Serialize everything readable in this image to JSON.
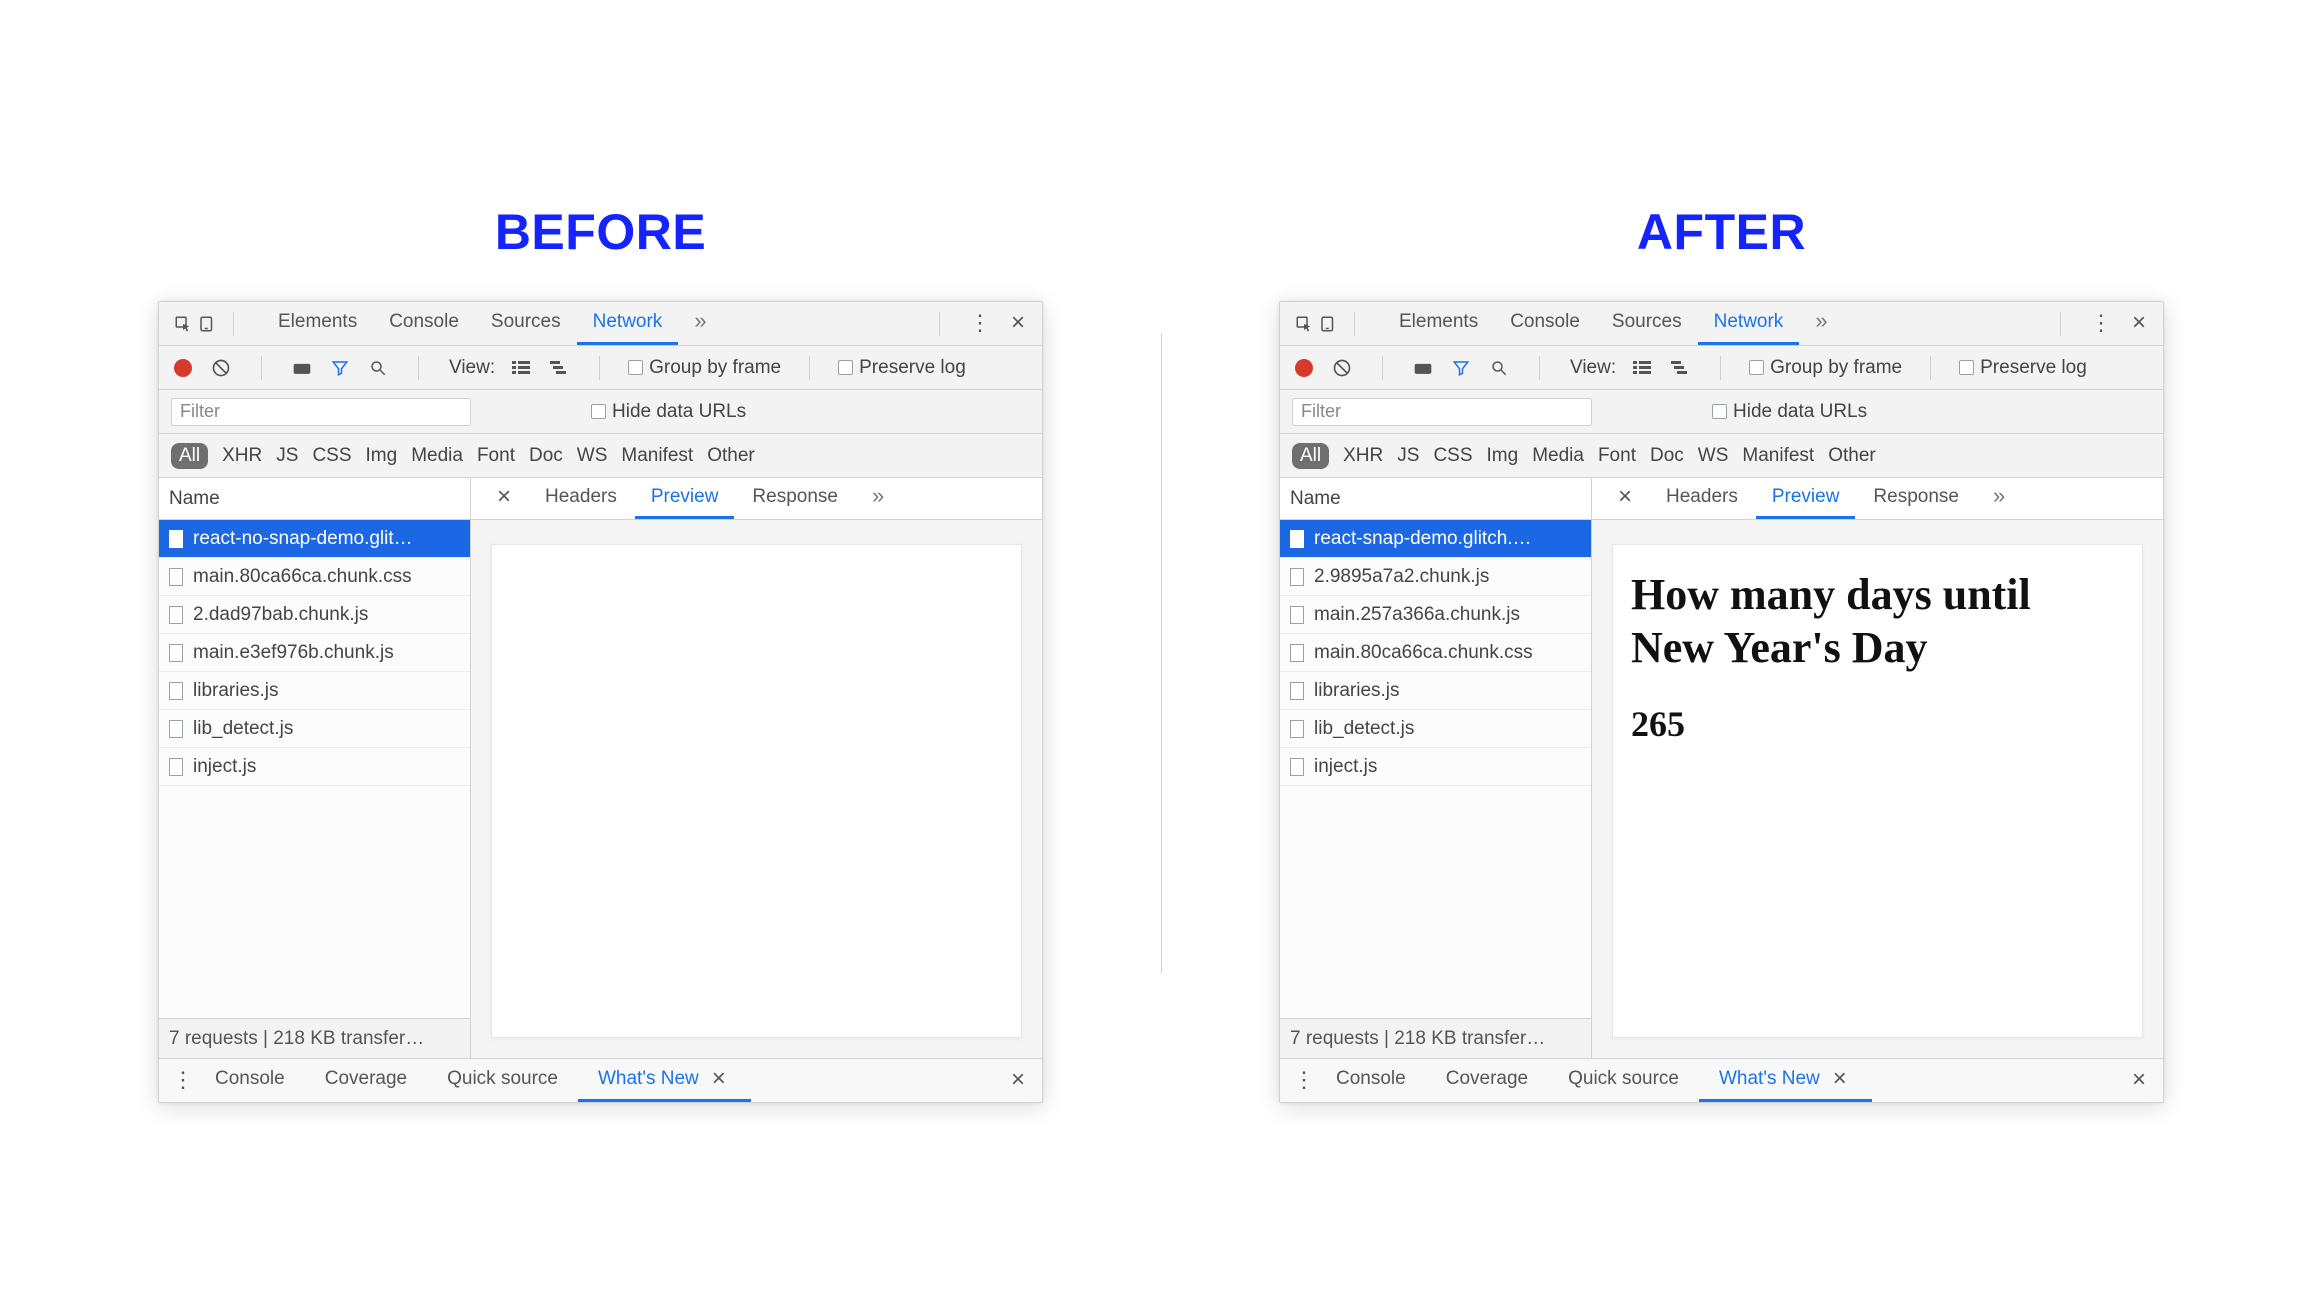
{
  "labels": {
    "before": "BEFORE",
    "after": "AFTER"
  },
  "top_tabs": {
    "elements": "Elements",
    "console": "Console",
    "sources": "Sources",
    "network": "Network"
  },
  "toolbar": {
    "view": "View:",
    "group_by_frame": "Group by frame",
    "preserve_log": "Preserve log"
  },
  "filter": {
    "placeholder": "Filter",
    "hide_data_urls": "Hide data URLs"
  },
  "type_chips": {
    "all": "All",
    "xhr": "XHR",
    "js": "JS",
    "css": "CSS",
    "img": "Img",
    "media": "Media",
    "font": "Font",
    "doc": "Doc",
    "ws": "WS",
    "manifest": "Manifest",
    "other": "Other"
  },
  "name_header": "Name",
  "detail_tabs": {
    "headers": "Headers",
    "preview": "Preview",
    "response": "Response"
  },
  "status_text": "7 requests | 218 KB transfer…",
  "drawer_tabs": {
    "console": "Console",
    "coverage": "Coverage",
    "quick_source": "Quick source",
    "whats_new": "What's New"
  },
  "before": {
    "requests": [
      "react-no-snap-demo.glit…",
      "main.80ca66ca.chunk.css",
      "2.dad97bab.chunk.js",
      "main.e3ef976b.chunk.js",
      "libraries.js",
      "lib_detect.js",
      "inject.js"
    ],
    "preview_heading": "",
    "preview_count": ""
  },
  "after": {
    "requests": [
      "react-snap-demo.glitch.…",
      "2.9895a7a2.chunk.js",
      "main.257a366a.chunk.js",
      "main.80ca66ca.chunk.css",
      "libraries.js",
      "lib_detect.js",
      "inject.js"
    ],
    "preview_heading": "How many days until New Year's Day",
    "preview_count": "265"
  }
}
